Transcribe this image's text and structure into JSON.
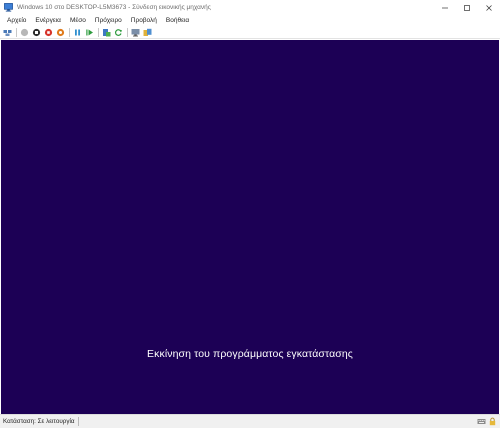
{
  "window": {
    "title": "Windows 10 στο DESKTOP-L5M3673 - Σύνδεση εικονικής μηχανής"
  },
  "menu": {
    "items": [
      "Αρχείο",
      "Ενέργεια",
      "Μέσο",
      "Πρόχειρο",
      "Προβολή",
      "Βοήθεια"
    ]
  },
  "toolbar": {
    "buttons": [
      "ctrl-alt-del-icon",
      "start-icon",
      "turn-off-icon",
      "shutdown-icon",
      "save-icon",
      "pause-icon",
      "resume-icon",
      "checkpoint-icon",
      "revert-icon",
      "enhanced-session-icon",
      "share-icon"
    ]
  },
  "vm": {
    "message": "Εκκίνηση του προγράμματος εγκατάστασης",
    "background_color": "#1c0055"
  },
  "statusbar": {
    "status": "Κατάσταση: Σε λειτουργία"
  }
}
